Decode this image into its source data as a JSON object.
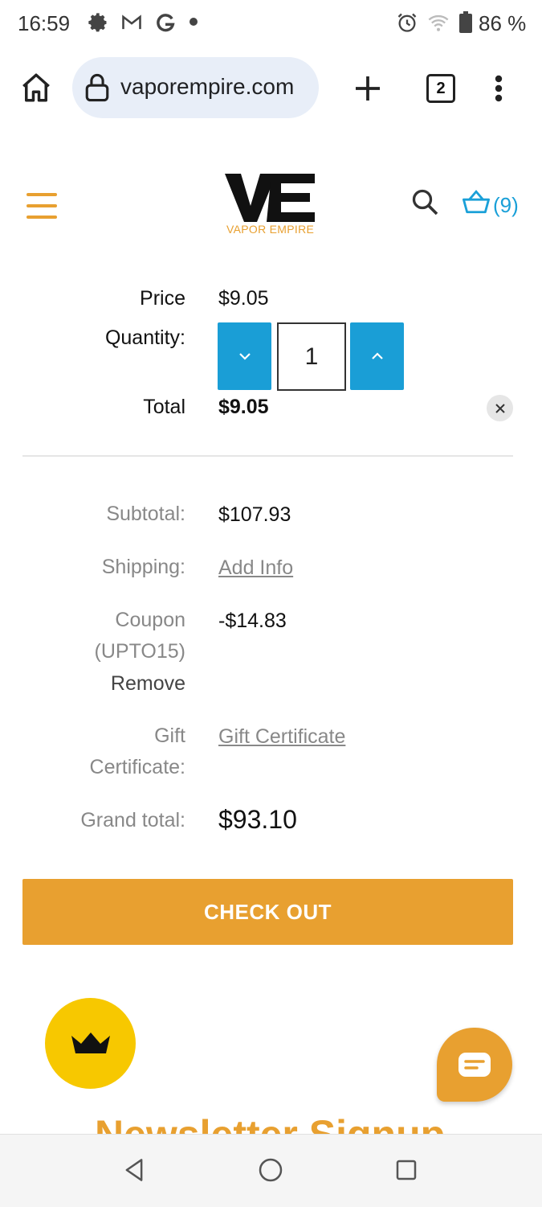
{
  "status_bar": {
    "time": "16:59",
    "icons": [
      "settings-icon",
      "gmail-icon",
      "google-icon",
      "dot-icon",
      "alarm-icon",
      "wifi-icon",
      "battery-icon"
    ],
    "battery": "86 %"
  },
  "browser": {
    "url": "vaporempire.com",
    "tab_count": "2"
  },
  "header": {
    "logo_caption": "VAPOR EMPIRE",
    "cart_count": "(9)",
    "accent_color": "#e8a030",
    "link_color": "#1aa0d8"
  },
  "cart_item": {
    "price_label": "Price",
    "price": "$9.05",
    "quantity_label": "Quantity:",
    "quantity": "1",
    "total_label": "Total",
    "total": "$9.05"
  },
  "totals": {
    "subtotal_label": "Subtotal:",
    "subtotal": "$107.93",
    "shipping_label": "Shipping:",
    "shipping_link": "Add Info",
    "coupon_label_line1": "Coupon",
    "coupon_label_line2": "(UPTO15)",
    "coupon_remove": "Remove",
    "coupon_value": "-$14.83",
    "gift_label_line1": "Gift",
    "gift_label_line2": "Certificate:",
    "gift_link": "Gift Certificate",
    "grand_total_label": "Grand total:",
    "grand_total": "$93.10"
  },
  "checkout_label": "CHECK OUT",
  "newsletter_heading": "Newsletter Signup"
}
